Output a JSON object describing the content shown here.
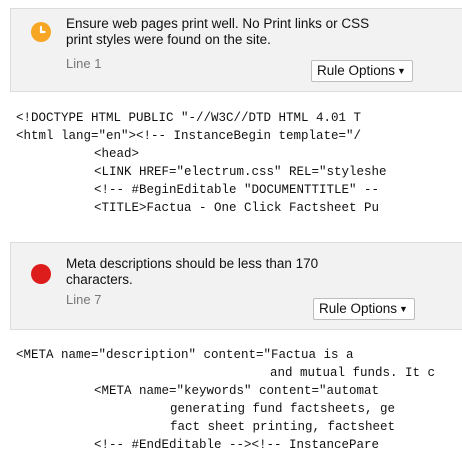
{
  "rules": [
    {
      "severity": "warning",
      "icon": "warning-icon",
      "color": "#f6a623",
      "message_lines": [
        "Ensure web pages print well. No Print links or CSS",
        "print styles were found on the site."
      ],
      "line_label": "Line 1",
      "options_label": "Rule Options"
    },
    {
      "severity": "error",
      "icon": "error-icon",
      "color": "#dd1c1c",
      "message_lines": [
        "Meta descriptions should be less than 170",
        "characters."
      ],
      "line_label": "Line 7",
      "options_label": "Rule Options"
    }
  ],
  "code_blocks": [
    [
      "<!DOCTYPE HTML PUBLIC \"-//W3C//DTD HTML 4.01 T",
      "<html lang=\"en\"><!-- InstanceBegin template=\"/",
      "<head>",
      "<LINK HREF=\"electrum.css\" REL=\"styleshe",
      "<!-- #BeginEditable \"DOCUMENTTITLE\" --",
      "<TITLE>Factua - One Click Factsheet Pu"
    ],
    [
      "<META name=\"description\" content=\"Factua is a",
      "and mutual funds. It c",
      "<META name=\"keywords\" content=\"automat",
      "generating fund factsheets, ge",
      "fact sheet printing, factsheet",
      "<!-- #EndEditable --><!-- InstancePare"
    ]
  ]
}
